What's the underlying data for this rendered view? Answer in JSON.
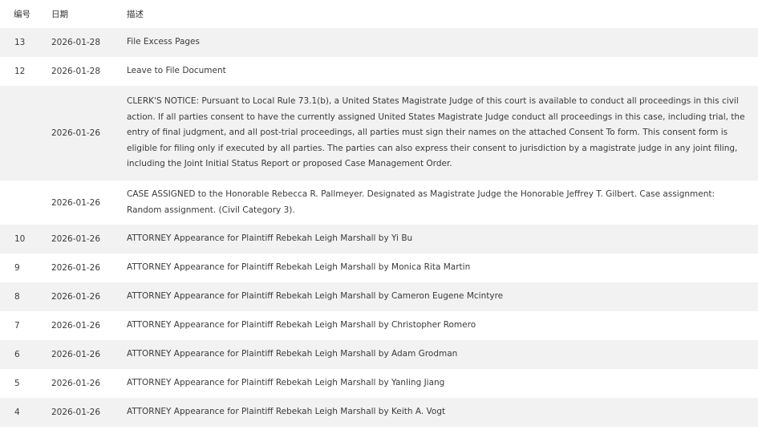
{
  "table": {
    "headers": {
      "num": "编号",
      "date": "日期",
      "desc": "描述"
    },
    "rows": [
      {
        "num": "13",
        "date": "2026-01-28",
        "desc": "File Excess Pages"
      },
      {
        "num": "12",
        "date": "2026-01-28",
        "desc": "Leave to File Document"
      },
      {
        "num": "",
        "date": "2026-01-26",
        "desc": "CLERK'S NOTICE: Pursuant to Local Rule 73.1(b), a United States Magistrate Judge of this court is available to conduct all proceedings in this civil action. If all parties consent to have the currently assigned United States Magistrate Judge conduct all proceedings in this case, including trial, the entry of final judgment, and all post-trial proceedings, all parties must sign their names on the attached Consent To form. This consent form is eligible for filing only if executed by all parties. The parties can also express their consent to jurisdiction by a magistrate judge in any joint filing, including the Joint Initial Status Report or proposed Case Management Order."
      },
      {
        "num": "",
        "date": "2026-01-26",
        "desc": "CASE ASSIGNED to the Honorable Rebecca R. Pallmeyer. Designated as Magistrate Judge the Honorable Jeffrey T. Gilbert. Case assignment: Random assignment. (Civil Category 3)."
      },
      {
        "num": "10",
        "date": "2026-01-26",
        "desc": "ATTORNEY Appearance for Plaintiff Rebekah Leigh Marshall by Yi Bu"
      },
      {
        "num": "9",
        "date": "2026-01-26",
        "desc": "ATTORNEY Appearance for Plaintiff Rebekah Leigh Marshall by Monica Rita Martin"
      },
      {
        "num": "8",
        "date": "2026-01-26",
        "desc": "ATTORNEY Appearance for Plaintiff Rebekah Leigh Marshall by Cameron Eugene Mcintyre"
      },
      {
        "num": "7",
        "date": "2026-01-26",
        "desc": "ATTORNEY Appearance for Plaintiff Rebekah Leigh Marshall by Christopher Romero"
      },
      {
        "num": "6",
        "date": "2026-01-26",
        "desc": "ATTORNEY Appearance for Plaintiff Rebekah Leigh Marshall by Adam Grodman"
      },
      {
        "num": "5",
        "date": "2026-01-26",
        "desc": "ATTORNEY Appearance for Plaintiff Rebekah Leigh Marshall by Yanling Jiang"
      },
      {
        "num": "4",
        "date": "2026-01-26",
        "desc": "ATTORNEY Appearance for Plaintiff Rebekah Leigh Marshall by Keith A. Vogt"
      }
    ]
  },
  "colors": {
    "stripe": "#f2f2f2",
    "text": "#3a3a3a"
  }
}
